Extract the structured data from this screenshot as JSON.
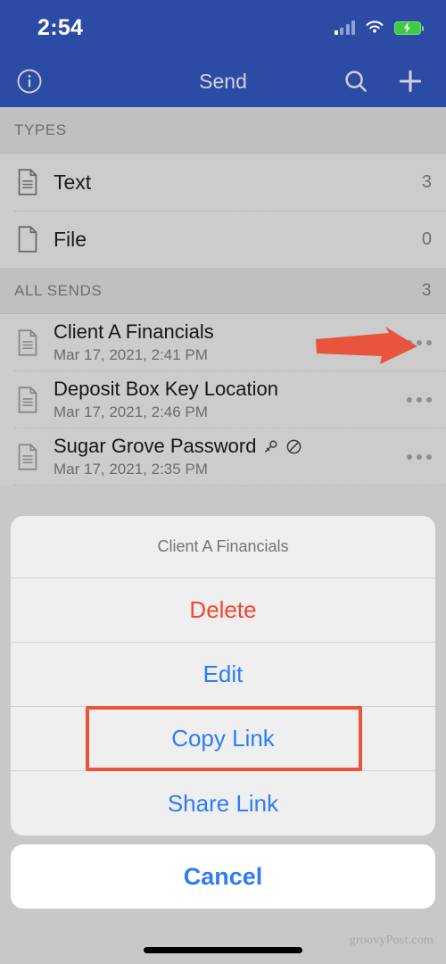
{
  "status_bar": {
    "time": "2:54",
    "signal_icon": "cellular-signal-icon",
    "wifi_icon": "wifi-icon",
    "battery_icon": "battery-charging-icon"
  },
  "nav_bar": {
    "title": "Send",
    "info_icon": "info-circle-icon",
    "search_icon": "search-icon",
    "add_icon": "plus-icon",
    "background_color": "#2b4ba5"
  },
  "types_section": {
    "header": "TYPES",
    "rows": [
      {
        "icon": "text-document-icon",
        "label": "Text",
        "count": "3"
      },
      {
        "icon": "file-document-icon",
        "label": "File",
        "count": "0"
      }
    ]
  },
  "all_sends_section": {
    "header": "ALL SENDS",
    "count": "3",
    "rows": [
      {
        "icon": "text-document-icon",
        "title": "Client A Financials",
        "date": "Mar 17, 2021, 2:41 PM",
        "badges": [],
        "more_icon": "more-options-icon"
      },
      {
        "icon": "text-document-icon",
        "title": "Deposit Box Key Location",
        "date": "Mar 17, 2021, 2:46 PM",
        "badges": [],
        "more_icon": "more-options-icon"
      },
      {
        "icon": "text-document-icon",
        "title": "Sugar Grove Password",
        "date": "Mar 17, 2021, 2:35 PM",
        "badges": [
          "key-icon",
          "disabled-icon"
        ],
        "more_icon": "more-options-icon"
      }
    ]
  },
  "action_sheet": {
    "title": "Client A Financials",
    "items": [
      {
        "label": "Delete",
        "style": "destructive",
        "highlighted": false
      },
      {
        "label": "Edit",
        "style": "normal",
        "highlighted": false
      },
      {
        "label": "Copy Link",
        "style": "normal",
        "highlighted": true
      },
      {
        "label": "Share Link",
        "style": "normal",
        "highlighted": false
      }
    ],
    "cancel_label": "Cancel"
  },
  "annotations": {
    "arrow_color": "#e8543c",
    "highlight_box_color": "#e8543c",
    "arrow_icon": "pointer-arrow-icon"
  },
  "watermark": "groovyPost.com",
  "colors": {
    "header_blue": "#2b4ba5",
    "section_gray": "#c0c0c2",
    "row_gray": "#cccccd",
    "sheet_gray": "#efeff0",
    "link_blue": "#2f7cf6",
    "destructive_red": "#f2472e"
  }
}
